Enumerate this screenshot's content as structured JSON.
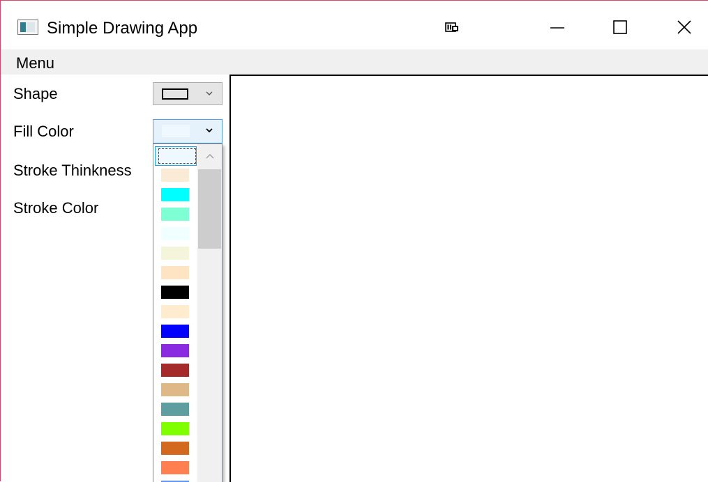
{
  "window": {
    "title": "Simple Drawing App",
    "accent_border": "#e2406a"
  },
  "titlebar": {
    "icons": [
      "app-icon",
      "snap-icon",
      "minimize-icon",
      "maximize-icon",
      "close-icon"
    ]
  },
  "menu": {
    "label": "Menu"
  },
  "panel": {
    "shape_label": "Shape",
    "fill_color_label": "Fill Color",
    "stroke_thickness_label": "Stroke Thinkness",
    "stroke_color_label": "Stroke Color"
  },
  "shape_combo": {
    "selected_shape": "rectangle"
  },
  "fill_combo": {
    "selected_color": "#f0f8ff",
    "open": true
  },
  "fill_dropdown": {
    "swatches": [
      "#f0f8ff",
      "#faebd7",
      "#00ffff",
      "#7fffd4",
      "#f0ffff",
      "#f5f5dc",
      "#ffe4c4",
      "#000000",
      "#ffebcd",
      "#0000ff",
      "#8a2be2",
      "#a52a2a",
      "#deb887",
      "#5f9ea0",
      "#7fff00",
      "#d2691e",
      "#ff7f50",
      "#6495ed"
    ],
    "selected_index": 0
  },
  "canvas": {
    "background": "#ffffff"
  }
}
